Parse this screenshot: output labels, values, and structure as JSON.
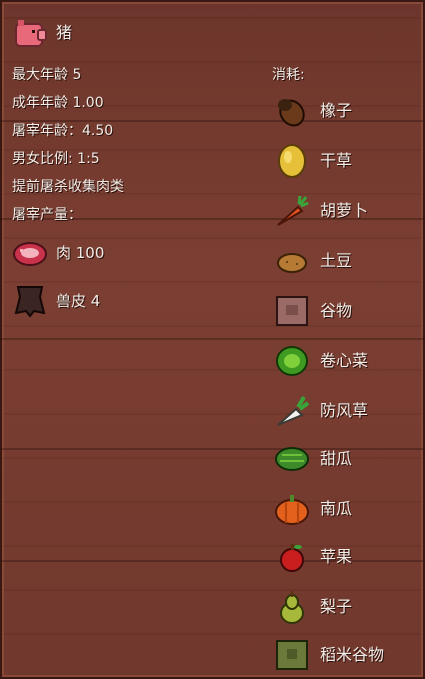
{
  "animal": {
    "name": "猪",
    "icon": "pig-icon"
  },
  "stats": {
    "max_age": "最大年龄 5",
    "adult_age": "成年年龄 1.00",
    "slaughter_age": "屠宰年龄：4.50",
    "gender_ratio": "男女比例: 1:5",
    "early_slaughter": "提前屠杀收集肉类",
    "yield_label": "屠宰产量："
  },
  "products": [
    {
      "label": "肉 100",
      "icon": "meat-icon"
    },
    {
      "label": "兽皮 4",
      "icon": "hide-icon"
    }
  ],
  "consumption": {
    "title": "消耗:",
    "items": [
      {
        "label": "橡子",
        "icon": "acorn-icon"
      },
      {
        "label": "干草",
        "icon": "hay-icon"
      },
      {
        "label": "胡萝卜",
        "icon": "carrot-icon"
      },
      {
        "label": "土豆",
        "icon": "potato-icon"
      },
      {
        "label": "谷物",
        "icon": "grain-sack-icon"
      },
      {
        "label": "卷心菜",
        "icon": "cabbage-icon"
      },
      {
        "label": "防风草",
        "icon": "parsnip-icon"
      },
      {
        "label": "甜瓜",
        "icon": "melon-icon"
      },
      {
        "label": "南瓜",
        "icon": "pumpkin-icon"
      },
      {
        "label": "苹果",
        "icon": "apple-icon"
      },
      {
        "label": "梨子",
        "icon": "pear-icon"
      },
      {
        "label": "稻米谷物",
        "icon": "rice-sack-icon"
      }
    ]
  },
  "colors": {
    "background": "#6f362b",
    "text": "#f1ece6"
  }
}
